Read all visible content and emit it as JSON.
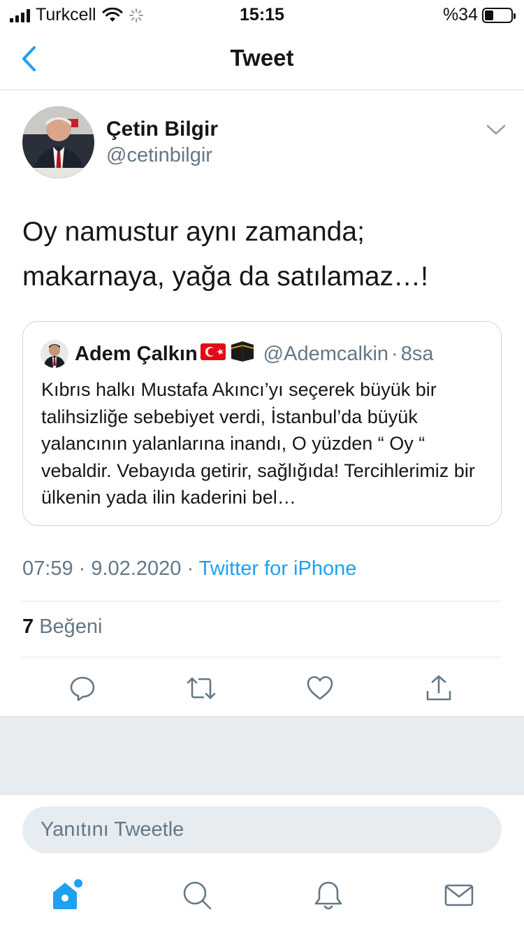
{
  "status_bar": {
    "carrier": "Turkcell",
    "time": "15:15",
    "battery_percent_label": "%34",
    "battery_level": 0.34
  },
  "nav": {
    "title": "Tweet"
  },
  "tweet": {
    "author_name": "Çetin Bilgir",
    "author_handle": "@cetinbilgir",
    "text_line1": "Oy namustur aynı zamanda;",
    "text_line2": "makarnaya, yağa da satılamaz…!",
    "time": "07:59",
    "date": "9.02.2020",
    "separator": "·",
    "source": "Twitter for iPhone",
    "likes_count": "7",
    "likes_label": "Beğeni"
  },
  "quoted_tweet": {
    "author_name": "Adem Çalkın",
    "name_emojis": [
      "🇹🇷",
      "🕋"
    ],
    "author_handle": "@Ademcalkin",
    "separator": "·",
    "time": "8sa",
    "text": "Kıbrıs halkı Mustafa Akıncı’yı seçerek büyük bir  talihsizliğe sebebiyet verdi, İstanbul’da büyük yalancının yalanlarına inandı, O yüzden “ Oy “ vebaldir. Vebayıda getirir, sağlığıda! Tercihlerimiz bir ülkenin yada ilin kaderini bel…"
  },
  "reply": {
    "placeholder": "Yanıtını Tweetle"
  },
  "icons": {
    "back": "chevron-left-icon",
    "caret": "chevron-down-icon",
    "reply": "reply-icon",
    "retweet": "retweet-icon",
    "like": "heart-icon",
    "share": "share-icon",
    "home": "home-icon",
    "search": "search-icon",
    "notifications": "bell-icon",
    "messages": "mail-icon"
  },
  "colors": {
    "accent": "#1da1f2",
    "secondary_text": "#657786",
    "border": "#e1e8ed",
    "gray_background": "#e6ecf0"
  }
}
